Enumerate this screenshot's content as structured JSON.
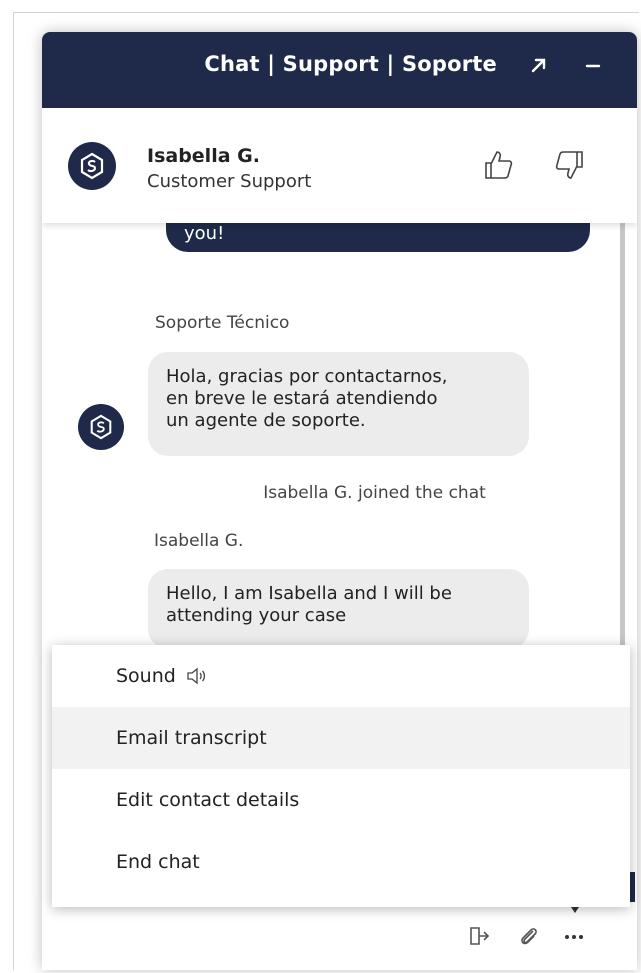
{
  "header": {
    "title": "Chat | Support | Soporte",
    "expand_icon": "arrow-up-right-icon",
    "minimize_icon": "minus-icon"
  },
  "agent": {
    "name": "Isabella G.",
    "role": "Customer Support",
    "feedback_icons": [
      "thumbs-up-icon",
      "thumbs-down-icon"
    ]
  },
  "messages": {
    "partial_bubble_text": "you!",
    "bot_sender": "Soporte Técnico",
    "bot_lines": [
      "Hola, gracias por contactarnos,",
      "en breve le estará atendiendo",
      "un agente de soporte."
    ],
    "system_join": "Isabella G. joined the chat",
    "agent_sender": "Isabella G.",
    "agent_lines": [
      "Hello, I am Isabella and I will be",
      "attending your case"
    ]
  },
  "menu": {
    "items": [
      {
        "label": "Sound",
        "icon": "speaker-icon"
      },
      {
        "label": "Email transcript"
      },
      {
        "label": "Edit contact details"
      },
      {
        "label": "End chat"
      }
    ]
  },
  "footer": {
    "icons": [
      "exit-icon",
      "paperclip-icon",
      "more-icon"
    ]
  },
  "colors": {
    "brand": "#1f2a4a",
    "bubble": "#ececec",
    "menu_hover": "#f2f2f2"
  }
}
